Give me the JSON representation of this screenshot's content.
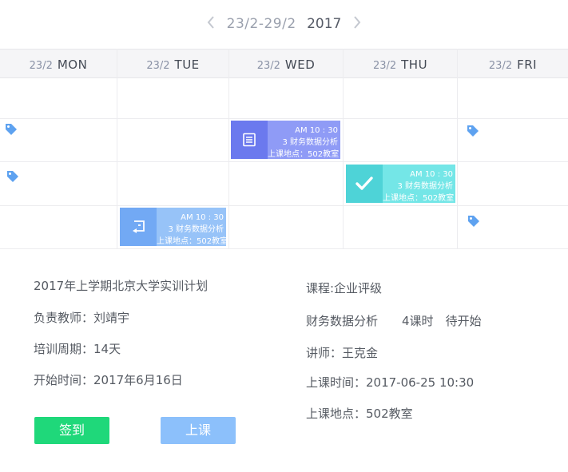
{
  "week_nav": {
    "prev_icon": "chevron-left-icon",
    "next_icon": "chevron-right-icon",
    "range": "23/2-29/2",
    "year": "2017"
  },
  "calendar": {
    "days": [
      {
        "date": "23/2",
        "weekday": "MON"
      },
      {
        "date": "23/2",
        "weekday": "TUE"
      },
      {
        "date": "23/2",
        "weekday": "WED"
      },
      {
        "date": "23/2",
        "weekday": "THU"
      },
      {
        "date": "23/2",
        "weekday": "FRI"
      }
    ],
    "events": [
      {
        "day": "WED",
        "time": "AM 10 : 30",
        "course": "3 财务数据分析",
        "location": "上课地点：502教室",
        "icon": "document-icon",
        "color": "#6b79ee"
      },
      {
        "day": "THU",
        "time": "AM 10 : 30",
        "course": "3 财务数据分析",
        "location": "上课地点：502教室",
        "icon": "check-icon",
        "color": "#4ed3d7"
      },
      {
        "day": "TUE",
        "time": "AM 10 : 30",
        "course": "3 财务数据分析",
        "location": "上课地点：502教室",
        "icon": "return-icon",
        "color": "#72a9f4"
      }
    ],
    "tag_icon": "tag-icon",
    "tag_color": "#5ea2f0"
  },
  "plan": {
    "title": "2017年上学期北京大学实训计划",
    "teacher": "负责教师：刘靖宇",
    "period": "培训周期：14天",
    "start": "开始时间：2017年6月16日"
  },
  "course": {
    "name": "课程:企业评级",
    "subject": "财务数据分析",
    "hours": "4课时",
    "status": "待开始",
    "lecturer": "讲师：王克金",
    "time": "上课时间：2017-06-25  10:30",
    "location": "上课地点：502教室"
  },
  "actions": {
    "signin": "签到",
    "attend": "上课"
  }
}
